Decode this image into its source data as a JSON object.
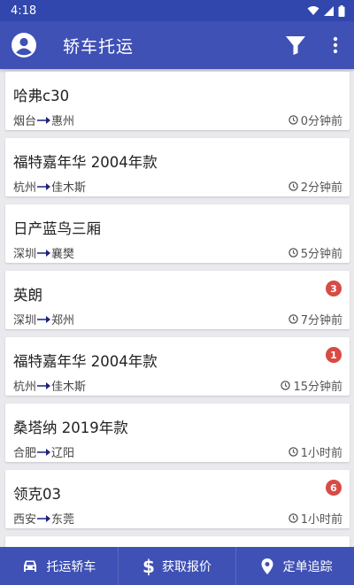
{
  "status_bar": {
    "time": "4:18"
  },
  "app_bar": {
    "title": "轿车托运"
  },
  "orders": [
    {
      "title": "哈弗c30",
      "from": "烟台",
      "to": "惠州",
      "time": "0分钟前",
      "badge": ""
    },
    {
      "title": "福特嘉年华 2004年款",
      "from": "杭州",
      "to": "佳木斯",
      "time": "2分钟前",
      "badge": ""
    },
    {
      "title": "日产蓝鸟三厢",
      "from": "深圳",
      "to": "襄樊",
      "time": "5分钟前",
      "badge": ""
    },
    {
      "title": "英朗",
      "from": "深圳",
      "to": "郑州",
      "time": "7分钟前",
      "badge": "3"
    },
    {
      "title": "福特嘉年华 2004年款",
      "from": "杭州",
      "to": "佳木斯",
      "time": "15分钟前",
      "badge": "1"
    },
    {
      "title": "桑塔纳 2019年款",
      "from": "合肥",
      "to": "辽阳",
      "time": "1小时前",
      "badge": ""
    },
    {
      "title": "领克03",
      "from": "西安",
      "to": "东莞",
      "time": "1小时前",
      "badge": "6"
    }
  ],
  "bottom_nav": {
    "items": [
      {
        "label": "托运轿车",
        "icon": "car-icon"
      },
      {
        "label": "获取报价",
        "icon": "dollar-icon"
      },
      {
        "label": "定单追踪",
        "icon": "location-pin-icon"
      }
    ]
  },
  "colors": {
    "primary": "#3f51b5",
    "badge": "#d74b45",
    "arrow": "#1a237e"
  }
}
